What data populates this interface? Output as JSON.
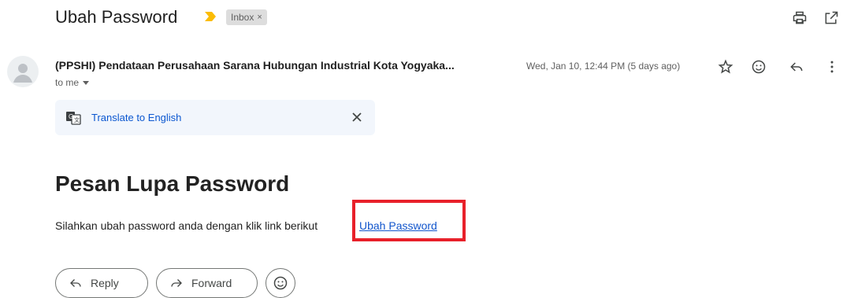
{
  "email": {
    "subject": "Ubah Password",
    "label_chip": "Inbox",
    "label_chip_close": "×",
    "sender": "(PPSHI) Pendataan Perusahaan Sarana Hubungan Industrial Kota Yogyaka...",
    "date": "Wed, Jan 10, 12:44 PM (5 days ago)",
    "recipient": "to me",
    "translate_label": "Translate to English",
    "body_heading": "Pesan Lupa Password",
    "body_text": "Silahkan ubah password anda dengan klik link berikut",
    "body_link": "Ubah Password"
  },
  "actions": {
    "reply": "Reply",
    "forward": "Forward"
  },
  "colors": {
    "highlight_box": "#e8202a",
    "link": "#1155cc",
    "translate_link": "#0b57d0",
    "importance_marker": "#fbbc04"
  },
  "icons": [
    "importance-marker-icon",
    "print-icon",
    "open-in-new-window-icon",
    "avatar-person-icon",
    "star-icon",
    "emoji-icon",
    "reply-icon",
    "more-vert-icon",
    "chevron-down-icon",
    "translate-icon",
    "close-icon",
    "forward-icon"
  ]
}
